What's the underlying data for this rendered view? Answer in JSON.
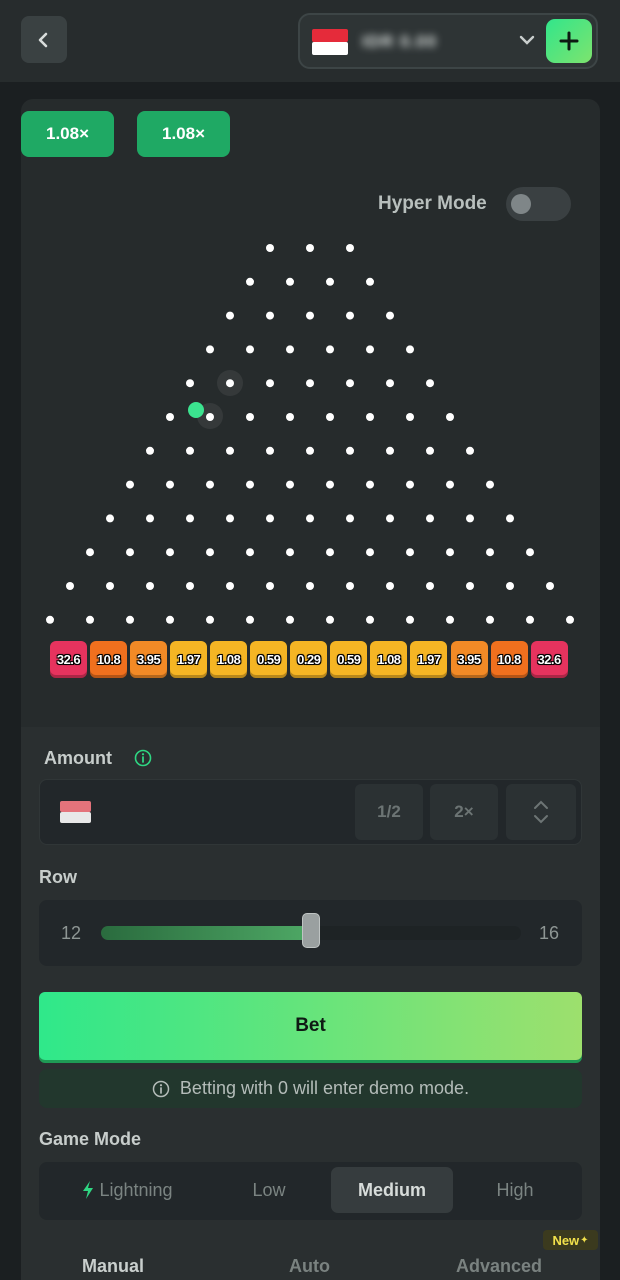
{
  "header": {
    "balance_text": "IDR 0.00",
    "add_label": "+"
  },
  "recent_multipliers": [
    "1.08×",
    "1.08×"
  ],
  "hyper_mode": {
    "label": "Hyper Mode",
    "enabled": false
  },
  "board": {
    "rows": 12,
    "buckets": [
      {
        "value": "32.6",
        "color": "#e6335e"
      },
      {
        "value": "10.8",
        "color": "#f0701e"
      },
      {
        "value": "3.95",
        "color": "#f28a26"
      },
      {
        "value": "1.97",
        "color": "#f5b524"
      },
      {
        "value": "1.08",
        "color": "#f5b524"
      },
      {
        "value": "0.59",
        "color": "#f5b524"
      },
      {
        "value": "0.29",
        "color": "#f5b524"
      },
      {
        "value": "0.59",
        "color": "#f5b524"
      },
      {
        "value": "1.08",
        "color": "#f5b524"
      },
      {
        "value": "1.97",
        "color": "#f5b524"
      },
      {
        "value": "3.95",
        "color": "#f28a26"
      },
      {
        "value": "10.8",
        "color": "#f0701e"
      },
      {
        "value": "32.6",
        "color": "#e6335e"
      }
    ],
    "ball_color": "#3be38f"
  },
  "amount": {
    "label": "Amount",
    "half_label": "1/2",
    "double_label": "2×"
  },
  "row": {
    "label": "Row",
    "min": "12",
    "max": "16",
    "value": 12,
    "slider_fraction": 0.5
  },
  "bet": {
    "button_label": "Bet",
    "demo_note": "Betting with 0 will enter demo mode."
  },
  "game_mode": {
    "label": "Game Mode",
    "options": [
      "Lightning",
      "Low",
      "Medium",
      "High"
    ],
    "selected": "Medium"
  },
  "tabs": {
    "items": [
      "Manual",
      "Auto",
      "Advanced"
    ],
    "selected": "Manual",
    "new_badge": "New"
  },
  "colors": {
    "accent_green": "#2fe88a",
    "badge_green": "#1fa964"
  }
}
